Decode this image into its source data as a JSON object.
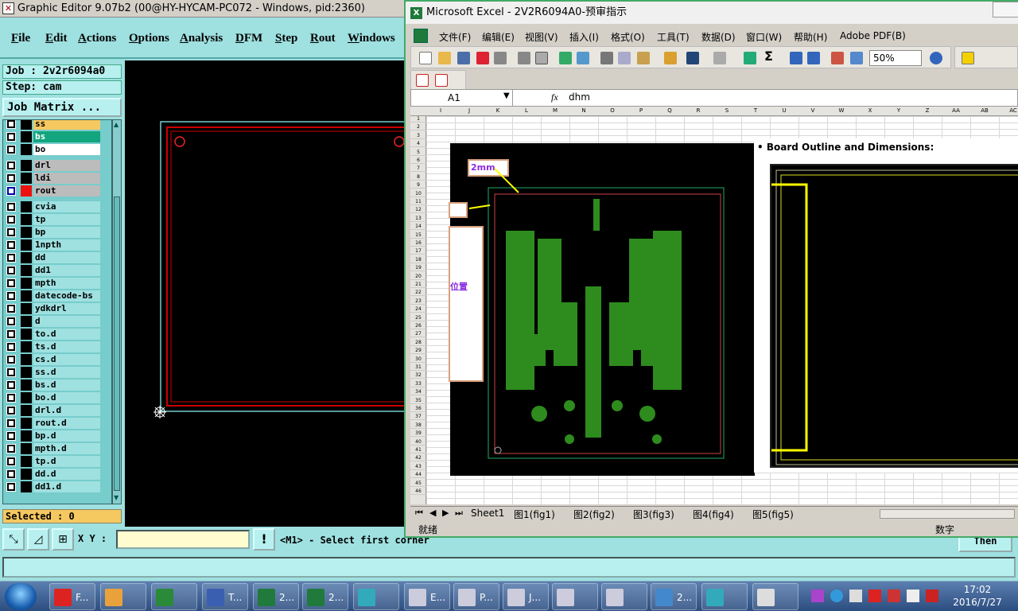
{
  "graphic_editor": {
    "title": "Graphic Editor 9.07b2 (00@HY-HYCAM-PC072 - Windows, pid:2360)",
    "menu": [
      "File",
      "Edit",
      "Actions",
      "Options",
      "Analysis",
      "DFM",
      "Step",
      "Rout",
      "Windows"
    ],
    "job": "Job : 2v2r6094a0",
    "step": "Step: cam",
    "job_matrix": "Job Matrix ...",
    "layers": [
      {
        "name": "ss",
        "style": "orange"
      },
      {
        "name": "bs",
        "style": "green"
      },
      {
        "name": "bo",
        "style": "white"
      },
      {
        "name": "drl",
        "style": "grey"
      },
      {
        "name": "ldi",
        "style": "grey"
      },
      {
        "name": "rout",
        "style": "grey",
        "active": true
      },
      {
        "name": "cvia",
        "style": "cyan"
      },
      {
        "name": "tp",
        "style": "cyan"
      },
      {
        "name": "bp",
        "style": "cyan"
      },
      {
        "name": "1npth",
        "style": "cyan"
      },
      {
        "name": "dd",
        "style": "cyan"
      },
      {
        "name": "dd1",
        "style": "cyan"
      },
      {
        "name": "mpth",
        "style": "cyan"
      },
      {
        "name": "datecode-bs",
        "style": "cyan"
      },
      {
        "name": "ydkdrl",
        "style": "cyan"
      },
      {
        "name": "d",
        "style": "cyan"
      },
      {
        "name": "to.d",
        "style": "cyan"
      },
      {
        "name": "ts.d",
        "style": "cyan"
      },
      {
        "name": "cs.d",
        "style": "cyan"
      },
      {
        "name": "ss.d",
        "style": "cyan"
      },
      {
        "name": "bs.d",
        "style": "cyan"
      },
      {
        "name": "bo.d",
        "style": "cyan"
      },
      {
        "name": "drl.d",
        "style": "cyan"
      },
      {
        "name": "rout.d",
        "style": "cyan"
      },
      {
        "name": "bp.d",
        "style": "cyan"
      },
      {
        "name": "mpth.d",
        "style": "cyan"
      },
      {
        "name": "tp.d",
        "style": "cyan"
      },
      {
        "name": "dd.d",
        "style": "cyan"
      },
      {
        "name": "dd1.d",
        "style": "cyan"
      }
    ],
    "selected": "Selected : 0",
    "xy_label": "X Y :",
    "xy_value": "",
    "status_message": "<M1> - Select first corner",
    "then_button": "Then"
  },
  "excel": {
    "title": "Microsoft Excel - 2V2R6094A0-预审指示",
    "menu": [
      "文件(F)",
      "编辑(E)",
      "视图(V)",
      "插入(I)",
      "格式(O)",
      "工具(T)",
      "数据(D)",
      "窗口(W)",
      "帮助(H)",
      "Adobe PDF(B)"
    ],
    "zoom": "50%",
    "name_box": "A1",
    "fx": "fx",
    "formula_value": "dhm",
    "columns": [
      "I",
      "J",
      "K",
      "L",
      "M",
      "N",
      "O",
      "P",
      "Q",
      "R",
      "S",
      "T",
      "U",
      "V",
      "W",
      "X",
      "Y",
      "Z",
      "AA",
      "AB",
      "AC"
    ],
    "rows": [
      "1",
      "2",
      "3",
      "4",
      "5",
      "6",
      "7",
      "8",
      "9",
      "10",
      "11",
      "12",
      "13",
      "14",
      "15",
      "16",
      "17",
      "18",
      "19",
      "20",
      "21",
      "22",
      "23",
      "24",
      "25",
      "26",
      "27",
      "28",
      "29",
      "30",
      "31",
      "32",
      "33",
      "34",
      "35",
      "36",
      "37",
      "38",
      "39",
      "40",
      "41",
      "42",
      "43",
      "44",
      "45",
      "46"
    ],
    "annotation_2mm": "2mm",
    "annotation_position": "位置",
    "board_outline_heading": "• Board Outline and Dimensions:",
    "sheets": [
      "Sheet1",
      "图1(fig1)",
      "图2(fig2)",
      "图3(fig3)",
      "图4(fig4)",
      "图5(fig5)"
    ],
    "status_ready": "就绪",
    "status_num": "数字"
  },
  "taskbar": {
    "items": [
      {
        "label": "F...",
        "icon": "foxit-icon"
      },
      {
        "label": "",
        "icon": "shell-icon"
      },
      {
        "label": "",
        "icon": "p-app-icon"
      },
      {
        "label": "T...",
        "icon": "floppy-icon"
      },
      {
        "label": "2...",
        "icon": "excel-doc-icon"
      },
      {
        "label": "2...",
        "icon": "excel-doc-icon"
      },
      {
        "label": "",
        "icon": "disc-icon"
      },
      {
        "label": "E...",
        "icon": "x-window-icon"
      },
      {
        "label": "P...",
        "icon": "x-window-icon"
      },
      {
        "label": "J...",
        "icon": "x-window-icon"
      },
      {
        "label": "",
        "icon": "x-window-icon"
      },
      {
        "label": "",
        "icon": "x-window-icon"
      },
      {
        "label": "2...",
        "icon": "text-doc-icon"
      },
      {
        "label": "",
        "icon": "disc-icon"
      },
      {
        "label": "",
        "icon": "notepad-icon"
      }
    ],
    "time": "17:02",
    "date": "2016/7/27"
  }
}
